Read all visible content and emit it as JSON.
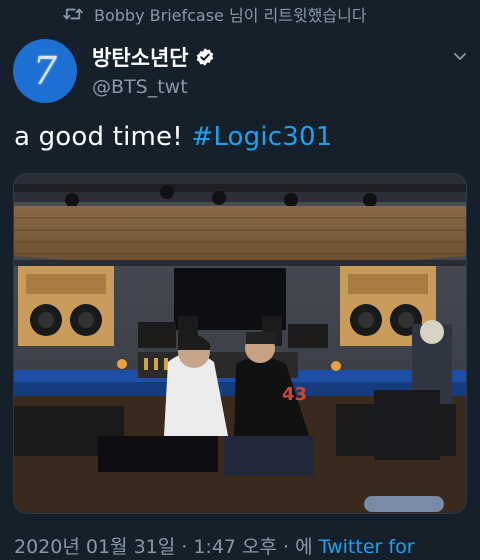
{
  "retweet": {
    "text": "Bobby Briefcase 님이 리트윗했습니다",
    "icon": "retweet-icon"
  },
  "author": {
    "name": "방탄소년단",
    "handle": "@BTS_twt",
    "avatar_glyph": "7",
    "verified_icon": "verified-badge-icon"
  },
  "tweet": {
    "text": "a good time! ",
    "hashtag": "#Logic301"
  },
  "timestamp": {
    "text": "2020년 01월 31일 · 1:47 오후 · 에 ",
    "client": "Twitter for"
  },
  "colors": {
    "background": "#15202b",
    "secondary_text": "#8899a6",
    "accent": "#1da1f2"
  }
}
